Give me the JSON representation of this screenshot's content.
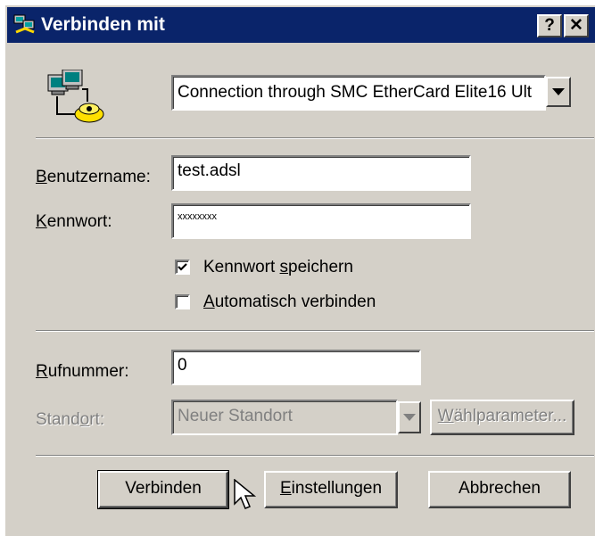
{
  "window": {
    "title": "Verbinden mit",
    "help_button": "?",
    "close_button": "✕"
  },
  "connection": {
    "selected": "Connection through SMC EtherCard Elite16 Ult"
  },
  "username": {
    "label_key": "B",
    "label_rest": "enutzername:",
    "value": "test.adsl"
  },
  "password": {
    "label_key": "K",
    "label_rest": "ennwort:",
    "value": "xxxxxxxx"
  },
  "save_password": {
    "label_pre": "Kennwort ",
    "label_key": "s",
    "label_rest": "peichern",
    "checked": true
  },
  "auto_connect": {
    "label_key": "A",
    "label_rest": "utomatisch verbinden",
    "checked": false
  },
  "phone": {
    "label_key": "R",
    "label_rest": "ufnummer:",
    "value": "0"
  },
  "location": {
    "label_pre": "Stand",
    "label_key": "o",
    "label_rest": "rt:",
    "selected": "Neuer Standort"
  },
  "dial_params": {
    "label_key": "W",
    "label_rest": "ählparameter..."
  },
  "buttons": {
    "connect": "Verbinden",
    "settings_key": "E",
    "settings_rest": "instellungen",
    "cancel": "Abbrechen"
  },
  "colors": {
    "titlebar": "#0a246a",
    "face": "#d4d0c8",
    "disabled_text": "#808080"
  },
  "icons": [
    "network-computers-icon",
    "dial-up-connection-icon",
    "help-icon",
    "close-icon",
    "dropdown-arrow-icon",
    "checkmark-icon",
    "mouse-cursor-icon"
  ]
}
